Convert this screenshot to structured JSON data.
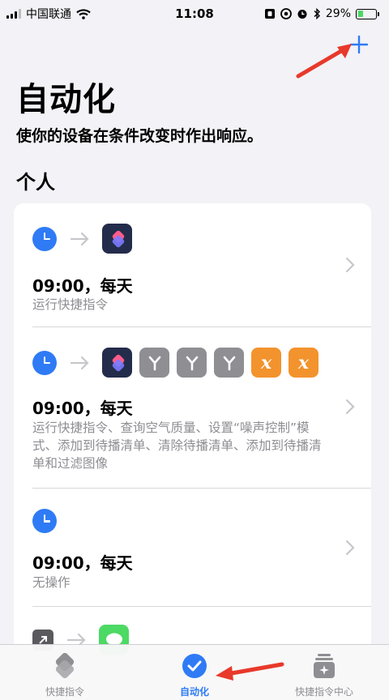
{
  "status_bar": {
    "carrier": "中国联通",
    "time": "11:08",
    "battery_percent": "29%",
    "battery_level": 0.29
  },
  "header": {
    "add_icon": "plus-icon",
    "title": "自动化",
    "subtitle": "使你的设备在条件改变时作出响应。"
  },
  "section": {
    "title": "个人"
  },
  "automations": [
    {
      "time": "09:00，每天",
      "description": "运行快捷指令",
      "icons": [
        "clock-icon",
        "shortcuts-icon"
      ]
    },
    {
      "time": "09:00，每天",
      "description": "运行快捷指令、查询空气质量、设置“噪声控制”模式、添加到待播清单、清除待播清单、添加到待播清单和过滤图像",
      "icons": [
        "clock-icon",
        "shortcuts-icon",
        "scripting-icon",
        "scripting-icon",
        "scripting-icon",
        "variable-icon",
        "variable-icon"
      ]
    },
    {
      "time": "09:00，每天",
      "description": "无操作",
      "icons": [
        "clock-icon"
      ]
    },
    {
      "time": "",
      "description": "",
      "icons": [
        "open-app-icon",
        "messages-icon"
      ]
    }
  ],
  "tab_bar": {
    "tabs": [
      {
        "label": "快捷指令",
        "icon": "shortcuts-stack-icon",
        "active": false
      },
      {
        "label": "自动化",
        "icon": "automation-check-icon",
        "active": true
      },
      {
        "label": "快捷指令中心",
        "icon": "gallery-icon",
        "active": false
      }
    ]
  },
  "colors": {
    "accent": "#2f7bf5",
    "background": "#f2f2f7",
    "annotation": "#e8392b"
  }
}
